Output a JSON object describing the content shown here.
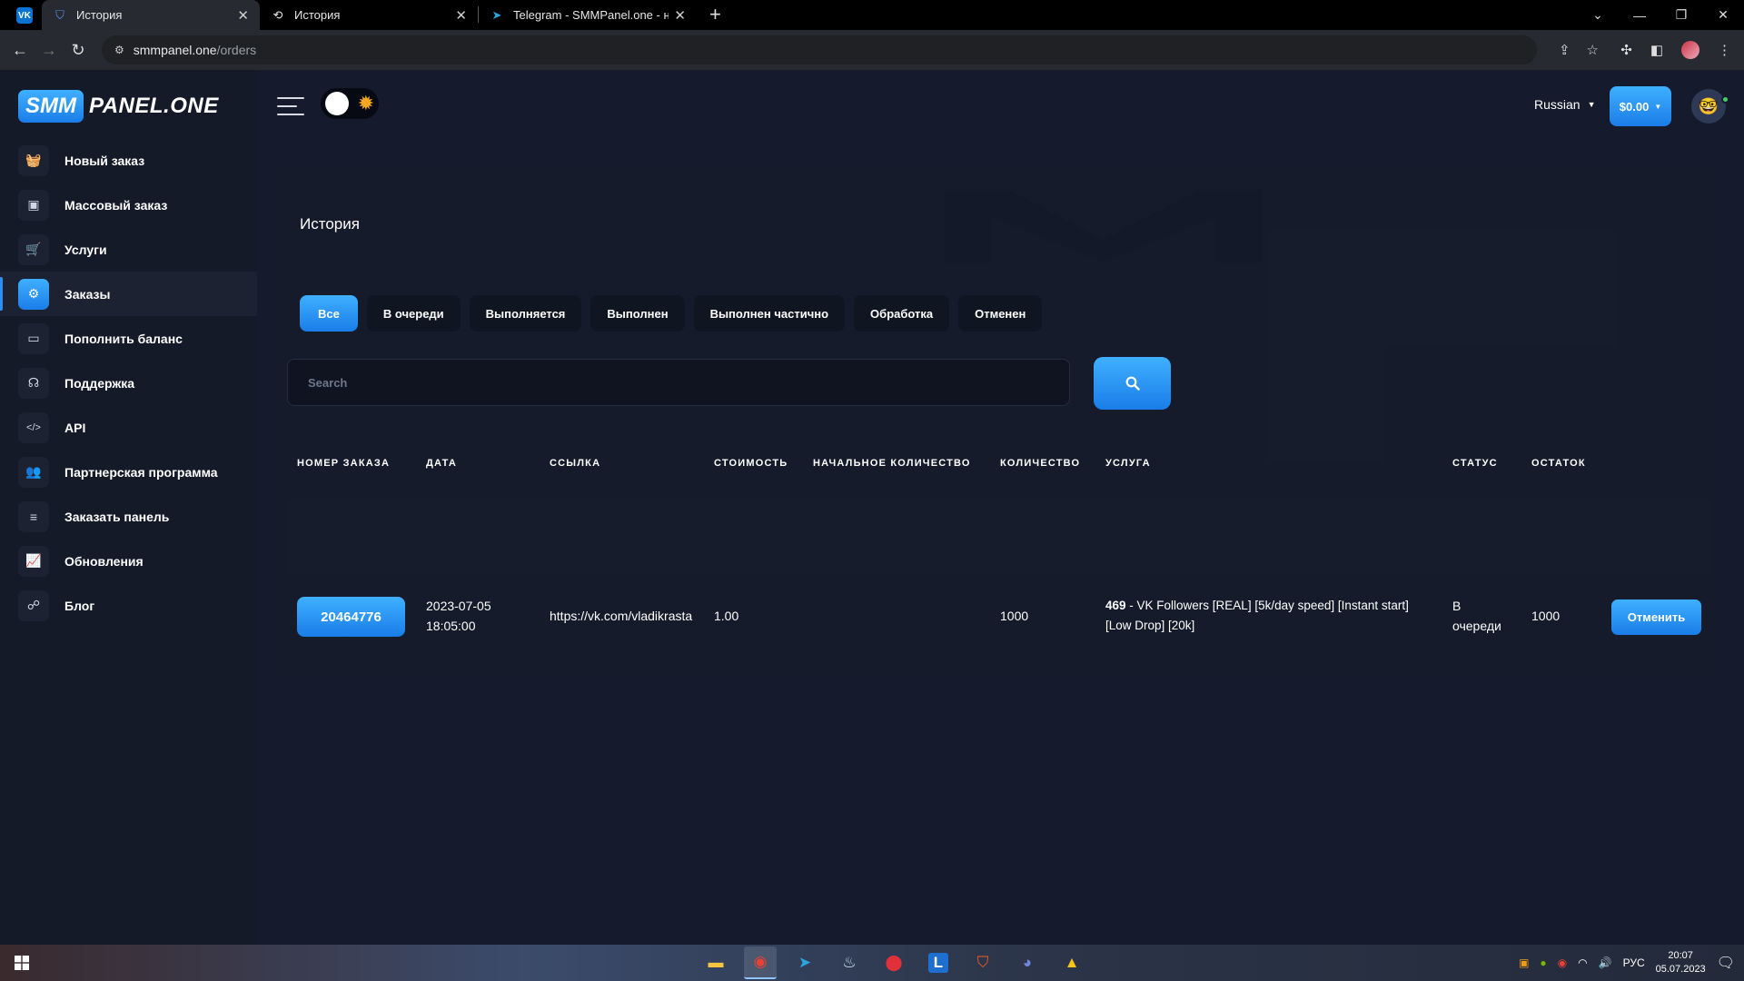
{
  "browser": {
    "tabs": [
      {
        "title": "История",
        "icon": "shield-icon",
        "active": true
      },
      {
        "title": "История",
        "icon": "history-icon",
        "active": false
      },
      {
        "title": "Telegram - SMMPanel.one - накр",
        "icon": "telegram-icon",
        "active": false
      }
    ],
    "url_host": "smmpanel.one",
    "url_path": "/orders",
    "vk_badge": "VK"
  },
  "brand": {
    "logo_left": "SMM",
    "logo_right": "PANEL.ONE"
  },
  "sidebar": {
    "items": [
      {
        "label": "Новый заказ",
        "icon": "basket-icon",
        "glyph": "🧺"
      },
      {
        "label": "Массовый заказ",
        "icon": "mass-order-icon",
        "glyph": "▣"
      },
      {
        "label": "Услуги",
        "icon": "cart-icon",
        "glyph": "🛒"
      },
      {
        "label": "Заказы",
        "icon": "orders-icon",
        "glyph": "⚙"
      },
      {
        "label": "Пополнить баланс",
        "icon": "wallet-icon",
        "glyph": "▭"
      },
      {
        "label": "Поддержка",
        "icon": "headset-icon",
        "glyph": "☊"
      },
      {
        "label": "API",
        "icon": "code-icon",
        "glyph": "</>"
      },
      {
        "label": "Партнерская программа",
        "icon": "partner-icon",
        "glyph": "👥"
      },
      {
        "label": "Заказать панель",
        "icon": "database-icon",
        "glyph": "≡"
      },
      {
        "label": "Обновления",
        "icon": "chart-icon",
        "glyph": "📈"
      },
      {
        "label": "Блог",
        "icon": "feed-icon",
        "glyph": "☍"
      }
    ]
  },
  "header": {
    "language": "Russian",
    "balance": "$0.00"
  },
  "page": {
    "title": "История",
    "filters": [
      "Все",
      "В очереди",
      "Выполняется",
      "Выполнен",
      "Выполнен частично",
      "Обработка",
      "Отменен"
    ],
    "search_placeholder": "Search"
  },
  "table": {
    "headers": [
      "НОМЕР ЗАКАЗА",
      "ДАТА",
      "ССЫЛКА",
      "СТОИМОСТЬ",
      "НАЧАЛЬНОЕ КОЛИЧЕСТВО",
      "КОЛИЧЕСТВО",
      "УСЛУГА",
      "СТАТУС",
      "ОСТАТОК"
    ],
    "rows": [
      {
        "order_id": "20464776",
        "date": "2023-07-05",
        "time": "18:05:00",
        "link": "https://vk.com/vladikrasta",
        "cost": "1.00",
        "start_count": "",
        "quantity": "1000",
        "service_id": "469",
        "service_name": " - VK Followers [REAL] [5k/day speed] [Instant start]",
        "service_name_2": "[Low Drop] [20k]",
        "status_1": "В",
        "status_2": "очереди",
        "remains": "1000",
        "action": "Отменить"
      }
    ]
  },
  "taskbar": {
    "lang": "РУС",
    "time": "20:07",
    "date": "05.07.2023"
  },
  "colors": {
    "accent": "#2b8ff5",
    "background": "#151b2c",
    "sidebar": "#151a29"
  }
}
